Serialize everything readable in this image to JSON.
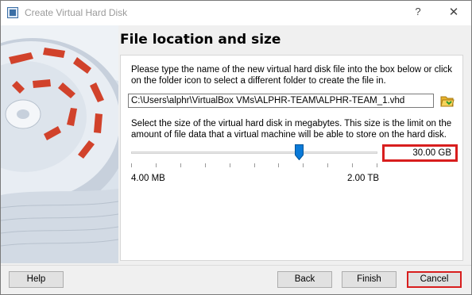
{
  "window": {
    "title": "Create Virtual Hard Disk",
    "help_glyph": "?",
    "close_glyph": "✕",
    "app_icon": "virtualbox-icon"
  },
  "page": {
    "heading": "File location and size",
    "location_instructions": "Please type the name of the new virtual hard disk file into the box below or click on the folder icon to select a different folder to create the file in.",
    "file_path": "C:\\Users\\alphr\\VirtualBox VMs\\ALPHR-TEAM\\ALPHR-TEAM_1.vhd",
    "folder_icon": "folder-open-icon",
    "size_instructions": "Select the size of the virtual hard disk in megabytes. This size is the limit on the amount of file data that a virtual machine will be able to store on the hard disk.",
    "size_value": "30.00 GB",
    "slider_min_label": "4.00 MB",
    "slider_max_label": "2.00 TB",
    "slider_position": 0.68,
    "highlight_color": "#d81e1e"
  },
  "buttons": {
    "help": "Help",
    "back": "Back",
    "finish": "Finish",
    "cancel": "Cancel"
  }
}
